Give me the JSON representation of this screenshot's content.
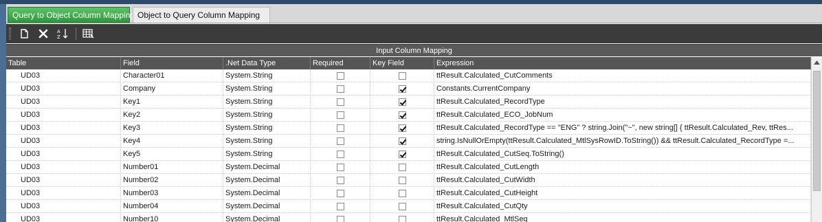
{
  "tabs": [
    {
      "label": "Query to Object Column Mapping",
      "active": true
    },
    {
      "label": "Object to Query Column Mapping",
      "active": false
    }
  ],
  "toolbar": {
    "buttons": [
      {
        "icon": "new-icon"
      },
      {
        "icon": "delete-icon"
      },
      {
        "icon": "sort-icon"
      },
      {
        "icon": "grid-layout-icon"
      }
    ]
  },
  "grid": {
    "band_title": "Input Column Mapping",
    "columns": [
      "Table",
      "Field",
      ".Net Data Type",
      "Required",
      "Key Field",
      "Expression"
    ],
    "rows": [
      {
        "table": "UD03",
        "field": "Character01",
        "type": "System.String",
        "required": false,
        "key": false,
        "expression": "ttResult.Calculated_CutComments"
      },
      {
        "table": "UD03",
        "field": "Company",
        "type": "System.String",
        "required": false,
        "key": true,
        "expression": "Constants.CurrentCompany"
      },
      {
        "table": "UD03",
        "field": "Key1",
        "type": "System.String",
        "required": false,
        "key": true,
        "expression": "ttResult.Calculated_RecordType"
      },
      {
        "table": "UD03",
        "field": "Key2",
        "type": "System.String",
        "required": false,
        "key": true,
        "expression": "ttResult.Calculated_ECO_JobNum"
      },
      {
        "table": "UD03",
        "field": "Key3",
        "type": "System.String",
        "required": false,
        "key": true,
        "expression": "ttResult.Calculated_RecordType == \"ENG\" ? string.Join(\"~\", new string[] { ttResult.Calculated_Rev, ttRes..."
      },
      {
        "table": "UD03",
        "field": "Key4",
        "type": "System.String",
        "required": false,
        "key": true,
        "expression": "string.IsNullOrEmpty(ttResult.Calculated_MtlSysRowID.ToString()) && ttResult.Calculated_RecordType =..."
      },
      {
        "table": "UD03",
        "field": "Key5",
        "type": "System.String",
        "required": false,
        "key": true,
        "expression": "ttResult.Calculated_CutSeq.ToString()"
      },
      {
        "table": "UD03",
        "field": "Number01",
        "type": "System.Decimal",
        "required": false,
        "key": false,
        "expression": "ttResult.Calculated_CutLength"
      },
      {
        "table": "UD03",
        "field": "Number02",
        "type": "System.Decimal",
        "required": false,
        "key": false,
        "expression": "ttResult.Calculated_CutWidth"
      },
      {
        "table": "UD03",
        "field": "Number03",
        "type": "System.Decimal",
        "required": false,
        "key": false,
        "expression": "ttResult.Calculated_CutHeight"
      },
      {
        "table": "UD03",
        "field": "Number04",
        "type": "System.Decimal",
        "required": false,
        "key": false,
        "expression": "ttResult.Calculated_CutQty"
      },
      {
        "table": "UD03",
        "field": "Number10",
        "type": "System.Decimal",
        "required": false,
        "key": false,
        "expression": "ttResult.Calculated_MtlSeq"
      }
    ]
  },
  "colors": {
    "active_tab": "#2d9a3a",
    "toolbar_bg": "#3b3b3b",
    "header_bg": "#555555"
  }
}
